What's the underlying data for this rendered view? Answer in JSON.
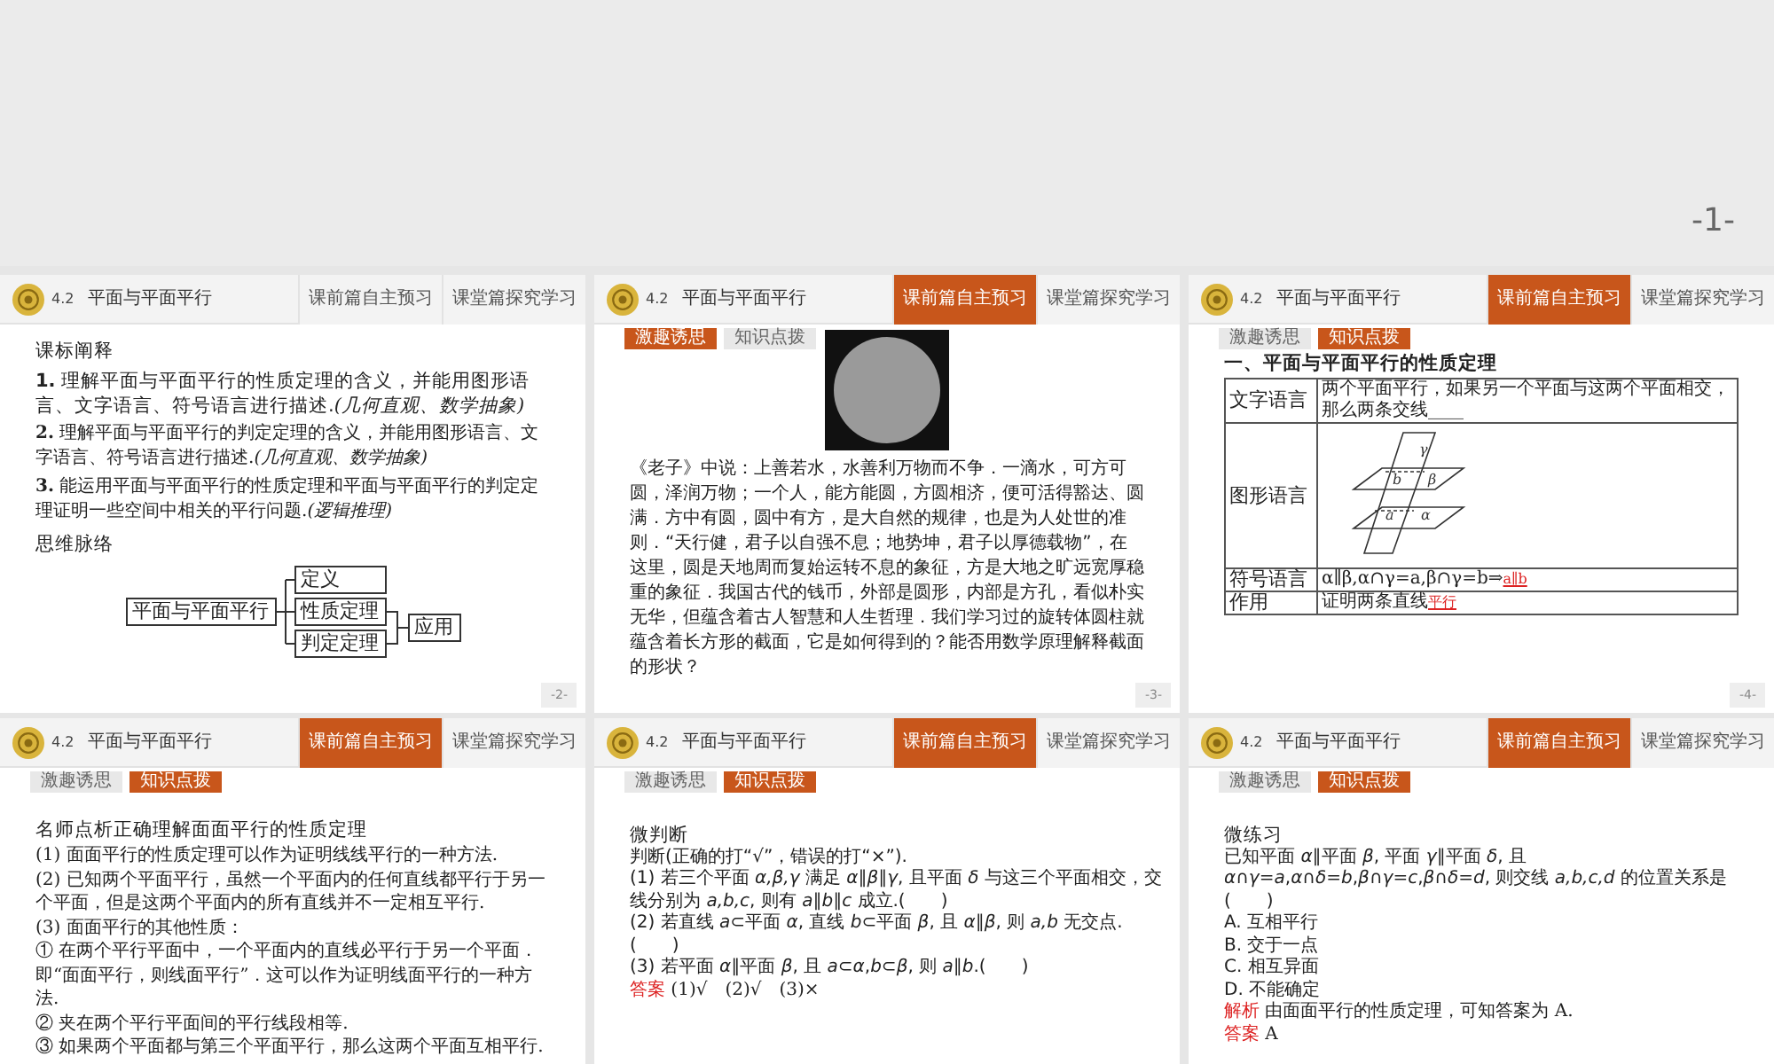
{
  "top_page": {
    "page_number": "-1-"
  },
  "slides": [
    {
      "kind": "outline",
      "section_no": "4.2",
      "section_title": "平面与平面平行",
      "tabs": [
        {
          "label": "课前篇自主预习",
          "selected": false
        },
        {
          "label": "课堂篇探究学习",
          "selected": false
        }
      ],
      "heading": "课标阐释",
      "items": [
        {
          "number": "1.",
          "text": "理解平面与平面平行的性质定理的含义，并能用图形语言、文字语言、符号语言进行描述.",
          "note": "(几何直观、数学抽象)",
          "kind": "main"
        },
        {
          "number": "2.",
          "text": "理解平面与平面平行的判定定理的含义，并能用图形语言、文字语言、符号语言进行描述.",
          "note": "(几何直观、数学抽象)",
          "kind": "minor"
        },
        {
          "number": "3.",
          "text": "能运用平面与平面平行的性质定理和平面与平面平行的判定定理证明一些空间中相关的平行问题.",
          "note": "(逻辑推理)",
          "kind": "minor"
        }
      ],
      "map_heading": "思维脉络",
      "mind_map": {
        "root": "平面与平面平行",
        "branches": [
          "定义",
          "性质定理",
          "判定定理"
        ],
        "target": "应用"
      },
      "page_number": "-2-"
    },
    {
      "kind": "intro",
      "section_no": "4.2",
      "section_title": "平面与平面平行",
      "tabs": [
        {
          "label": "课前篇自主预习",
          "selected": true
        },
        {
          "label": "课堂篇探究学习",
          "selected": false
        }
      ],
      "subtabs": [
        {
          "label": "激趣诱思",
          "selected": true
        },
        {
          "label": "知识点拨",
          "selected": false
        }
      ],
      "paragraph": "《老子》中说：上善若水，水善利万物而不争．一滴水，可方可圆，泽润万物；一个人，能方能圆，方圆相济，便可活得豁达、圆满．方中有圆，圆中有方，是大自然的规律，也是为人处世的准则．“天行健，君子以自强不息；地势坤，君子以厚德载物”，在这里，圆是天地周而复始运转不息的象征，方是大地之旷远宽厚稳重的象征．我国古代的钱币，外部是圆形，内部是方孔，看似朴实无华，但蕴含着古人智慧和人生哲理．我们学习过的旋转体圆柱就蕴含着长方形的截面，它是如何得到的？能否用数学原理解释截面的形状？",
      "page_number": "-3-"
    },
    {
      "kind": "table",
      "section_no": "4.2",
      "section_title": "平面与平面平行",
      "tabs": [
        {
          "label": "课前篇自主预习",
          "selected": true
        },
        {
          "label": "课堂篇探究学习",
          "selected": false
        }
      ],
      "subtabs": [
        {
          "label": "激趣诱思",
          "selected": false
        },
        {
          "label": "知识点拨",
          "selected": true
        }
      ],
      "heading": "一、平面与平面平行的性质定理",
      "rows": [
        {
          "kind": "text",
          "label": "文字语言",
          "text": "两个平面平行，如果另一个平面与这两个平面相交，那么两条交线____"
        },
        {
          "kind": "figure",
          "label": "图形语言",
          "figure_labels": [
            "γ",
            "b",
            "β",
            "a",
            "α"
          ]
        },
        {
          "kind": "text",
          "label": "符号语言",
          "text": "α∥β,α∩γ=a,β∩γ=b⇒",
          "answer": "a∥b"
        },
        {
          "kind": "text",
          "label": "作用",
          "text": "证明两条直线",
          "answer": "平行"
        }
      ],
      "page_number": "-4-"
    },
    {
      "kind": "text",
      "section_no": "4.2",
      "section_title": "平面与平面平行",
      "tabs": [
        {
          "label": "课前篇自主预习",
          "selected": true
        },
        {
          "label": "课堂篇探究学习",
          "selected": false
        }
      ],
      "subtabs": [
        {
          "label": "激趣诱思",
          "selected": false
        },
        {
          "label": "知识点拨",
          "selected": true
        }
      ],
      "heading": "名师点析正确理解面面平行的性质定理",
      "lines": [
        "(1) 面面平行的性质定理可以作为证明线线平行的一种方法.",
        "(2) 已知两个平面平行，虽然一个平面内的任何直线都平行于另一个平面，但是这两个平面内的所有直线并不一定相互平行.",
        "(3) 面面平行的其他性质：",
        "① 在两个平行平面中，一个平面内的直线必平行于另一个平面．即“面面平行，则线面平行”．这可以作为证明线面平行的一种方法.",
        "② 夹在两个平行平面间的平行线段相等.",
        "③ 如果两个平面都与第三个平面平行，那么这两个平面互相平行."
      ]
    },
    {
      "kind": "quiz",
      "section_no": "4.2",
      "section_title": "平面与平面平行",
      "tabs": [
        {
          "label": "课前篇自主预习",
          "selected": true
        },
        {
          "label": "课堂篇探究学习",
          "selected": false
        }
      ],
      "subtabs": [
        {
          "label": "激趣诱思",
          "selected": false
        },
        {
          "label": "知识点拨",
          "selected": true
        }
      ],
      "heading": "微判断",
      "lines": [
        "判断(正确的打“√”，错误的打“×”).",
        "(1) 若三个平面 *α,β,γ* 满足 *α*∥*β*∥*γ*, 且平面 *δ* 与这三个平面相交，交线分别为 *a,b,c*, 则有 *a*∥*b*∥*c* 成立.(　　)",
        "(2) 若直线 *a*⊂平面 *α*, 直线 *b*⊂平面 *β*, 且 *α*∥*β*, 则 *a,b* 无交点.(　　)",
        "(3) 若平面 *α*∥平面 *β*, 且 *a*⊂*α*,*b*⊂*β*, 则 *a*∥*b*.(　　)"
      ],
      "notes": [
        {
          "label": "答案",
          "text": "(1)√　(2)√　(3)×"
        }
      ]
    },
    {
      "kind": "quiz",
      "section_no": "4.2",
      "section_title": "平面与平面平行",
      "tabs": [
        {
          "label": "课前篇自主预习",
          "selected": true
        },
        {
          "label": "课堂篇探究学习",
          "selected": false
        }
      ],
      "subtabs": [
        {
          "label": "激趣诱思",
          "selected": false
        },
        {
          "label": "知识点拨",
          "selected": true
        }
      ],
      "heading": "微练习",
      "lines": [
        "已知平面 *α*∥平面 *β*, 平面 *γ*∥平面 *δ*, 且",
        "*α*∩*γ*=*a*,*α*∩*δ*=*b*,*β*∩*γ*=*c*,*β*∩*δ*=*d*, 则交线 *a,b,c,d* 的位置关系是(　　)",
        "A. 互相平行",
        "B. 交于一点",
        "C. 相互异面",
        "D. 不能确定"
      ],
      "notes": [
        {
          "label": "解析",
          "text": "由面面平行的性质定理，可知答案为 A."
        },
        {
          "label": "答案",
          "text": "A"
        }
      ]
    }
  ]
}
